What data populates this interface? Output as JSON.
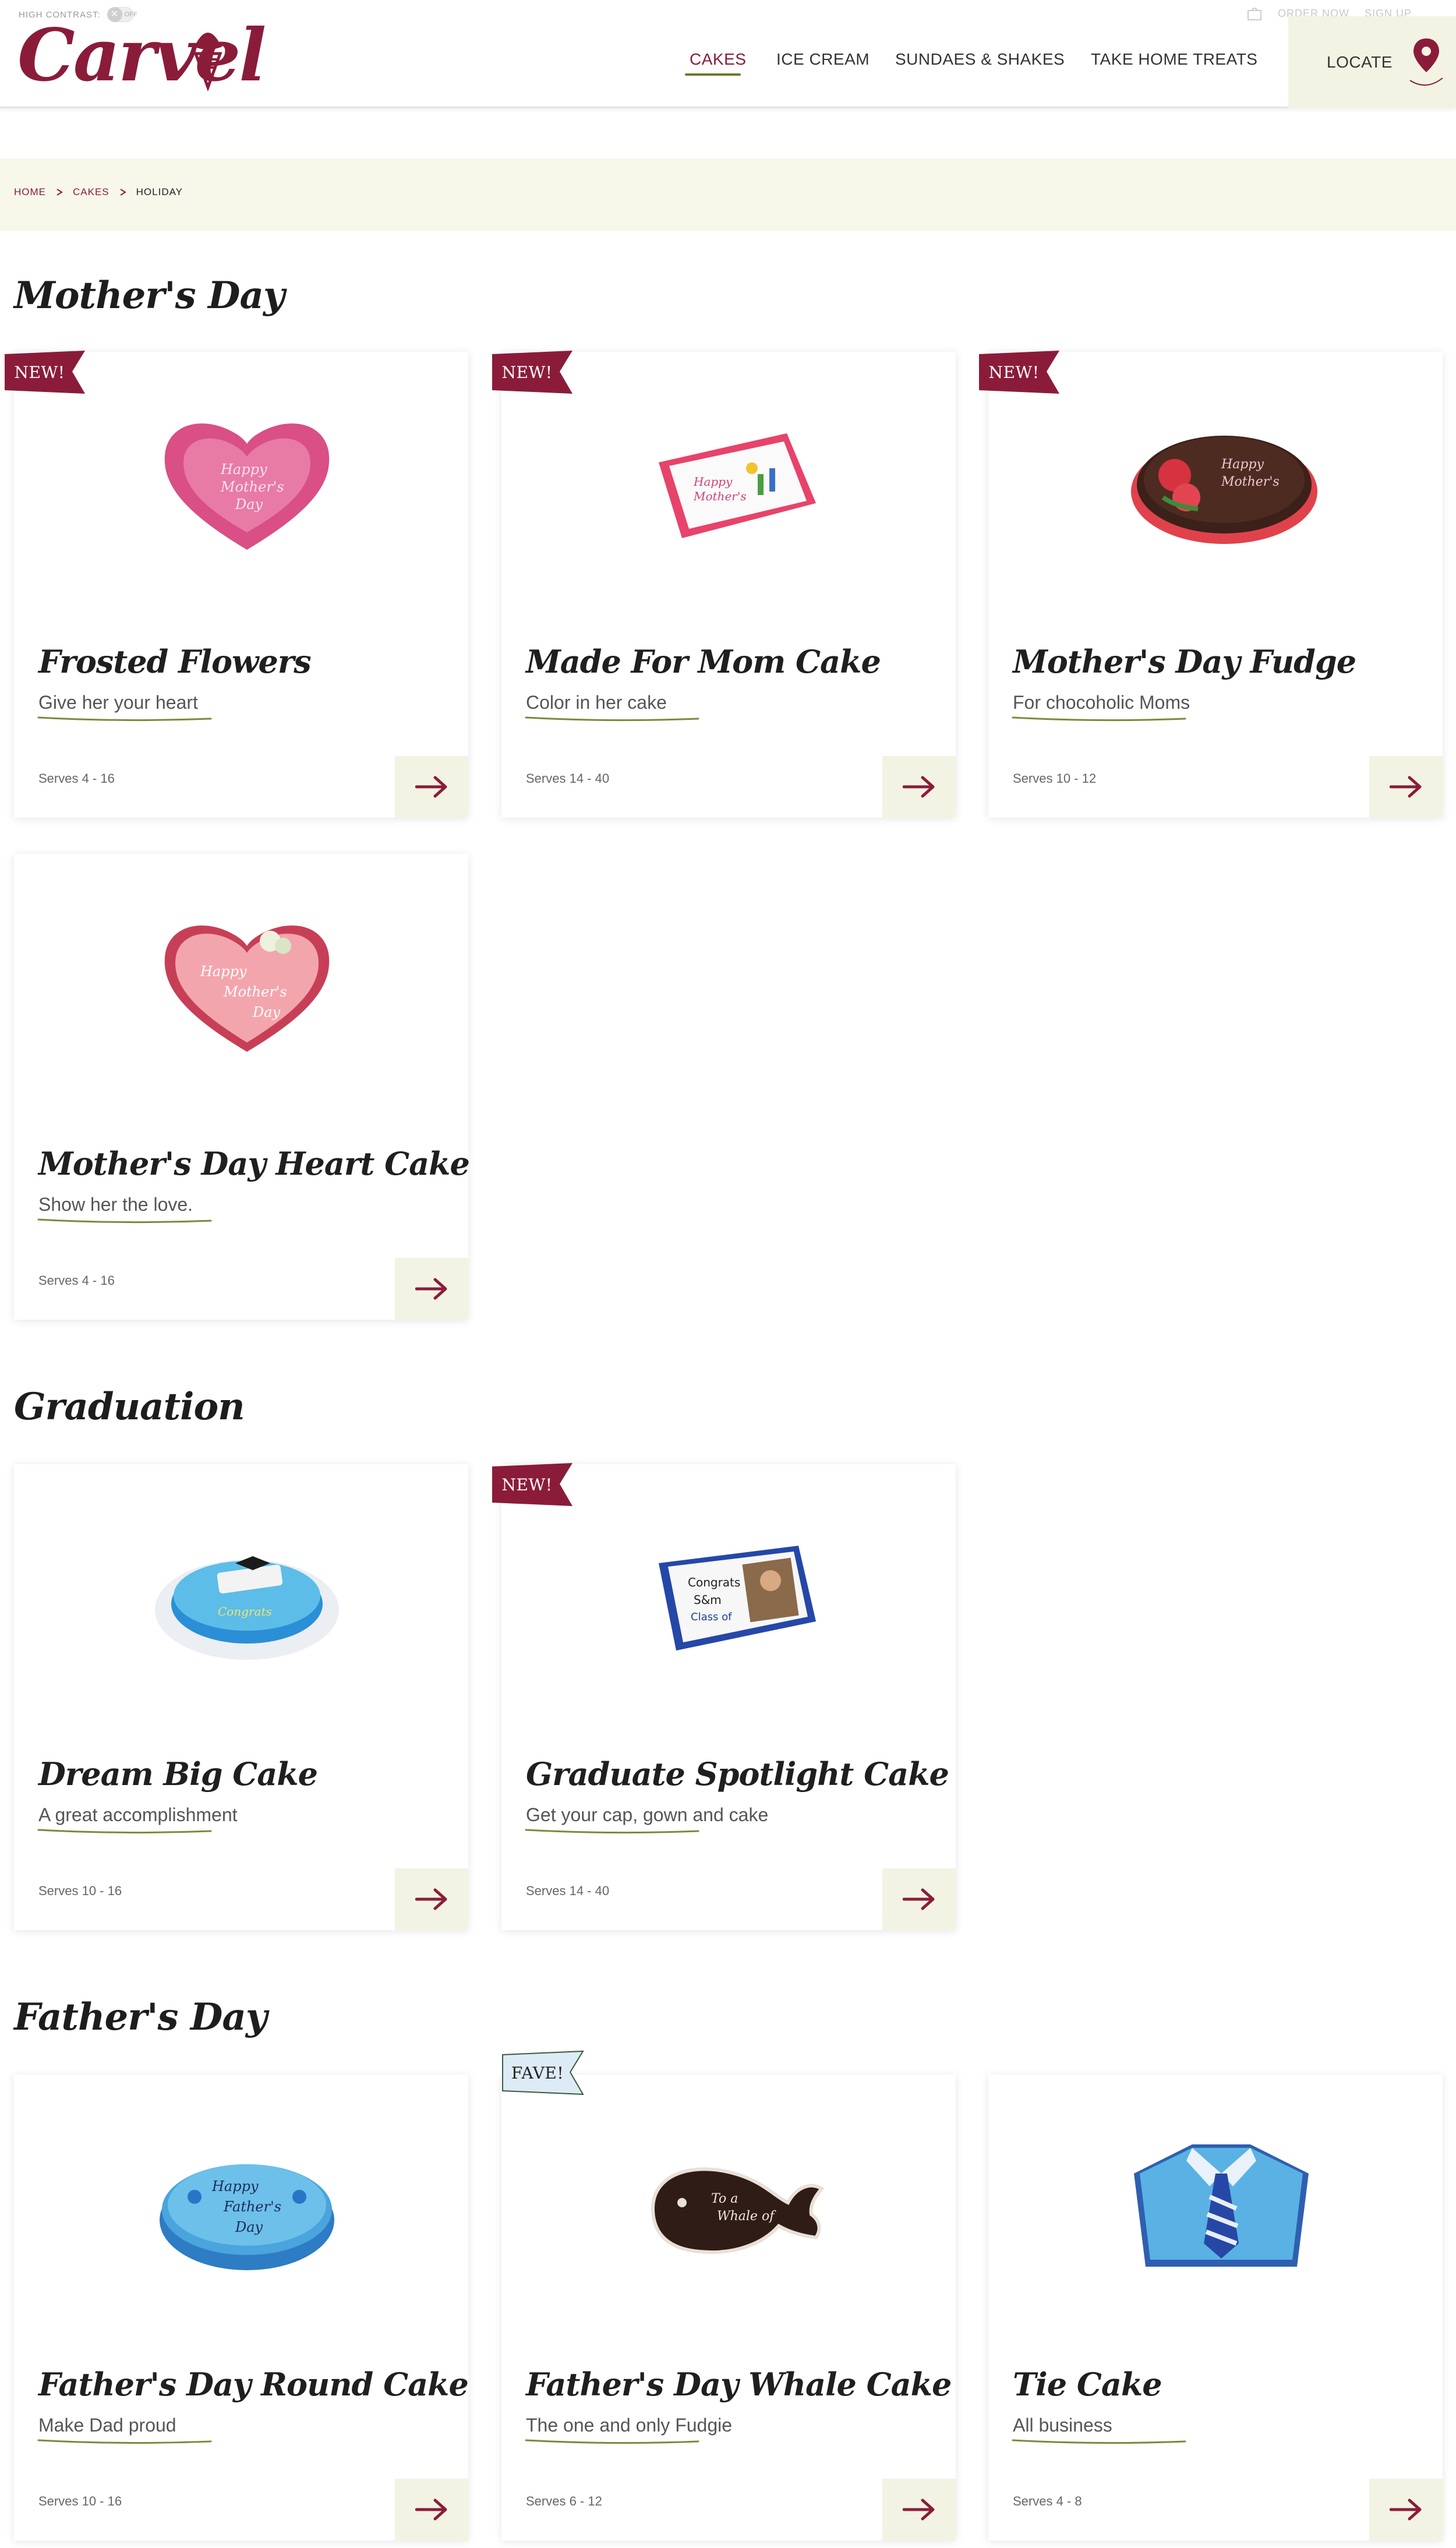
{
  "header": {
    "high_contrast_label": "HIGH CONTRAST:",
    "high_contrast_state": "OFF",
    "logo_text": "Carvel",
    "nav": [
      {
        "label": "CAKES",
        "active": true
      },
      {
        "label": "ICE CREAM",
        "active": false
      },
      {
        "label": "SUNDAES & SHAKES",
        "active": false
      },
      {
        "label": "TAKE HOME TREATS",
        "active": false
      }
    ],
    "utility_links": [
      "ORDER NOW",
      "SIGN UP"
    ],
    "locate_label": "LOCATE",
    "brand_color": "#8a1c3a",
    "accent_color": "#6b7a2a"
  },
  "breadcrumb": [
    {
      "label": "HOME",
      "link": true
    },
    {
      "label": "CAKES",
      "link": true
    },
    {
      "label": "HOLIDAY",
      "link": false
    }
  ],
  "sections": [
    {
      "title": "Mother's Day",
      "cards": [
        {
          "title": "Frosted Flowers",
          "subtitle": "Give her your heart",
          "serves": "Serves 4 - 16",
          "badge": "NEW!",
          "image_icon": "pink-heart-cake-icon"
        },
        {
          "title": "Made For Mom Cake",
          "subtitle": "Color in her cake",
          "serves": "Serves 14 - 40",
          "badge": "NEW!",
          "image_icon": "sheet-cake-icon"
        },
        {
          "title": "Mother's Day Fudge",
          "subtitle": "For chocoholic Moms",
          "serves": "Serves 10 - 12",
          "badge": "NEW!",
          "image_icon": "chocolate-oval-cake-icon"
        },
        {
          "title": "Mother's Day Heart Cake",
          "subtitle": "Show her the love.",
          "serves": "Serves 4 - 16",
          "badge": "",
          "image_icon": "light-pink-heart-cake-icon"
        }
      ]
    },
    {
      "title": "Graduation",
      "cards": [
        {
          "title": "Dream Big Cake",
          "subtitle": "A great accomplishment",
          "serves": "Serves 10 - 16",
          "badge": "",
          "image_icon": "blue-round-grad-cake-icon"
        },
        {
          "title": "Graduate Spotlight Cake",
          "subtitle": "Get your cap, gown and cake",
          "serves": "Serves 14 - 40",
          "badge": "NEW!",
          "image_icon": "photo-sheet-cake-icon"
        }
      ]
    },
    {
      "title": "Father's Day",
      "cards": [
        {
          "title": "Father's Day Round Cake",
          "subtitle": "Make Dad proud",
          "serves": "Serves 10 - 16",
          "badge": "",
          "image_icon": "blue-round-cake-icon"
        },
        {
          "title": "Father's Day Whale Cake",
          "subtitle": "The one and only Fudgie",
          "serves": "Serves 6 - 12",
          "badge": "FAVE!",
          "image_icon": "whale-cake-icon"
        },
        {
          "title": "Tie Cake",
          "subtitle": "All business",
          "serves": "Serves 4 - 8",
          "badge": "",
          "image_icon": "shirt-tie-cake-icon"
        }
      ]
    }
  ]
}
